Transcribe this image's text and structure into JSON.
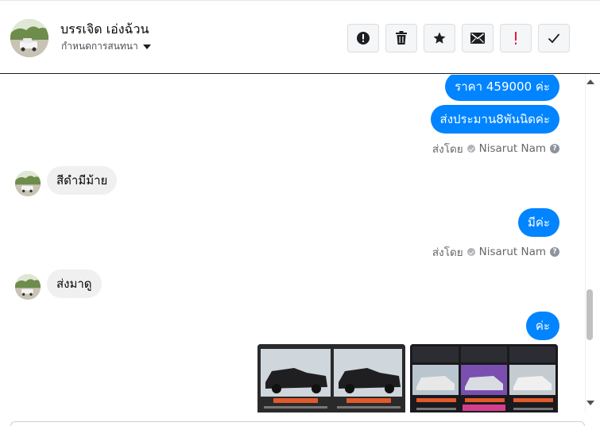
{
  "header": {
    "contact_name": "บรรเจิด เอ่งฉ้วน",
    "conversation_settings": "กำหนดการสนทนา",
    "tools": [
      {
        "name": "info-button",
        "icon": "alert-circle-icon"
      },
      {
        "name": "delete-button",
        "icon": "trash-icon"
      },
      {
        "name": "star-button",
        "icon": "star-icon"
      },
      {
        "name": "mail-button",
        "icon": "envelope-icon"
      },
      {
        "name": "spam-button",
        "icon": "exclamation-icon"
      },
      {
        "name": "done-button",
        "icon": "checkmark-icon"
      }
    ]
  },
  "messages": [
    {
      "direction": "out",
      "text": "ราคา 459000 ค่ะ"
    },
    {
      "direction": "out",
      "text": "ส่งประมาน8พันนิดค่ะ"
    },
    {
      "type": "sent_by",
      "label": "ส่งโดย",
      "name": "Nisarut Nam"
    },
    {
      "direction": "in",
      "text": "สีดำมีม้าย"
    },
    {
      "direction": "out",
      "text": "มีค่ะ"
    },
    {
      "type": "sent_by",
      "label": "ส่งโดย",
      "name": "Nisarut Nam"
    },
    {
      "direction": "in",
      "text": "ส่งมาดู"
    },
    {
      "direction": "out",
      "text": "ค่ะ"
    }
  ],
  "colors": {
    "outgoing_bubble": "#0084ff",
    "incoming_bubble": "#f0f0f0",
    "spam_icon": "#e41e3f"
  }
}
